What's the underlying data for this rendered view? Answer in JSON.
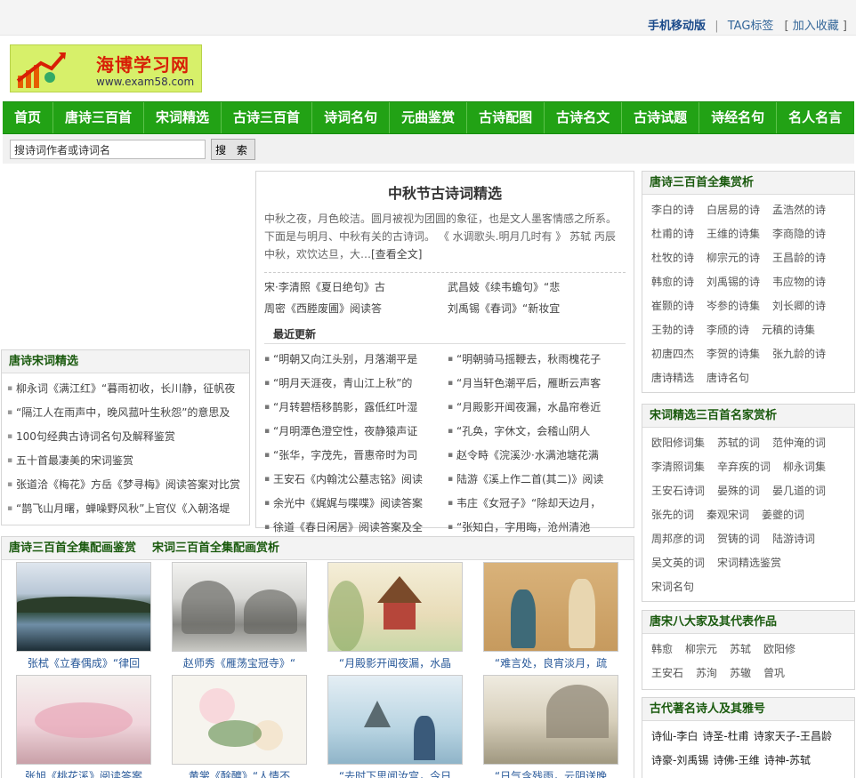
{
  "toplinks": {
    "mobile": "手机移动版",
    "sep": "|",
    "tag": "TAG标签",
    "fav": "加入收藏"
  },
  "logo": {
    "name": "海博学习网",
    "url": "www.exam58.com"
  },
  "nav": [
    "首页",
    "唐诗三百首",
    "宋词精选",
    "古诗三百首",
    "诗词名句",
    "元曲鉴赏",
    "古诗配图",
    "古诗名文",
    "古诗试题",
    "诗经名句",
    "名人名言"
  ],
  "search": {
    "placeholder": "搜诗词作者或诗词名",
    "value": "搜诗词作者或诗词名",
    "button": "搜 索"
  },
  "left": {
    "title": "唐诗宋词精选",
    "items": [
      "柳永词《满江红》“暮雨初收，长川静，征帆夜",
      "“隔江人在雨声中，晚风菰叶生秋怨”的意思及",
      "100句经典古诗词名句及解释鉴赏",
      "五十首最凄美的宋词鉴赏",
      "张道洽《梅花》方岳《梦寻梅》阅读答案对比赏",
      "“鹊飞山月曙，蝉噪野风秋”上官仪《入朝洛堤"
    ]
  },
  "center": {
    "title": "中秋节古诗词精选",
    "intro": "中秋之夜，月色皎洁。圆月被视为团圆的象征，也是文人墨客情感之所系。下面是与明月、中秋有关的古诗词。 《 水调歌头.明月几时有 》 苏轼 丙辰中秋，欢饮达旦，大…",
    "more": "[查看全文]",
    "pairs": [
      "宋·李清照《夏日绝句》古",
      "武昌妓《续韦蟾句》“悲",
      "周密《西塍废圃》阅读答",
      "刘禹锡《春词》“新妆宜"
    ],
    "recent_title": "最近更新",
    "recent": [
      "“明朝又向江头别，月落潮平是",
      "“明朝骑马摇鞭去，秋雨槐花子",
      "“明月天涯夜，青山江上秋”的",
      "“月当轩色潮平后，雁断云声客",
      "“月转碧梧移鹊影，露低红叶湿",
      "“月殿影开闻夜漏，水晶帘卷近",
      "“月明潭色澄空性，夜静猿声证",
      "“孔奂，字休文，会稽山阴人",
      "“张华，字茂先，晋惠帝时为司",
      "赵令畤《浣溪沙·水满池塘花满",
      "王安石《内翰沈公墓志铭》阅读",
      "陆游《溪上作二首(其二)》阅读",
      "余光中《娓娓与喋喋》阅读答案",
      "韦庄《女冠子》“除却天边月，",
      "徐道《春日闲居》阅读答案及全",
      "“张知白，字用晦，沧州清池"
    ]
  },
  "gallery": {
    "title1": "唐诗三百首全集配画鉴赏",
    "title2": "宋词三百首全集配画赏析",
    "items": [
      "张栻《立春偶成》“律回",
      "赵师秀《雁荡宝冠寺》“",
      "“月殿影开闻夜漏，水晶",
      "“难言处，良宵淡月，疏",
      "张旭《桃花溪》阅读答案",
      "黄裳《酴醾》“人情不",
      "“去时下思闻汝宫，今日",
      "“日气含残雨，云阴送晚"
    ]
  },
  "right": {
    "box1": {
      "title": "唐诗三百首全集赏析",
      "links": [
        "李白的诗",
        "白居易的诗",
        "孟浩然的诗",
        "杜甫的诗",
        "王维的诗集",
        "李商隐的诗",
        "杜牧的诗",
        "柳宗元的诗",
        "王昌龄的诗",
        "韩愈的诗",
        "刘禹锡的诗",
        "韦应物的诗",
        "崔颢的诗",
        "岑参的诗集",
        "刘长卿的诗",
        "王勃的诗",
        "李颀的诗",
        "元稹的诗集",
        "初唐四杰",
        "李贺的诗集",
        "张九龄的诗",
        "唐诗精选",
        "唐诗名句"
      ]
    },
    "box2": {
      "title": "宋词精选三百首名家赏析",
      "links": [
        "欧阳修词集",
        "苏轼的词",
        "范仲淹的词",
        "李清照词集",
        "辛弃疾的词",
        "柳永词集",
        "王安石诗词",
        "晏殊的词",
        "晏几道的词",
        "张先的词",
        "秦观宋词",
        "姜夔的词",
        "周邦彦的词",
        "贺铸的词",
        "陆游诗词",
        "吴文英的词",
        "宋词精选鉴赏",
        "宋词名句"
      ]
    },
    "box3": {
      "title": "唐宋八大家及其代表作品",
      "links": [
        "韩愈",
        "柳宗元",
        "苏轼",
        "欧阳修",
        "王安石",
        "苏洵",
        "苏辙",
        "曾巩"
      ]
    },
    "box4": {
      "title": "古代著名诗人及其雅号",
      "links": [
        "诗仙-李白",
        "诗圣-杜甫",
        "诗家天子-王昌龄",
        "诗豪-刘禹锡",
        "诗佛-王维",
        "诗神-苏轼"
      ]
    }
  }
}
